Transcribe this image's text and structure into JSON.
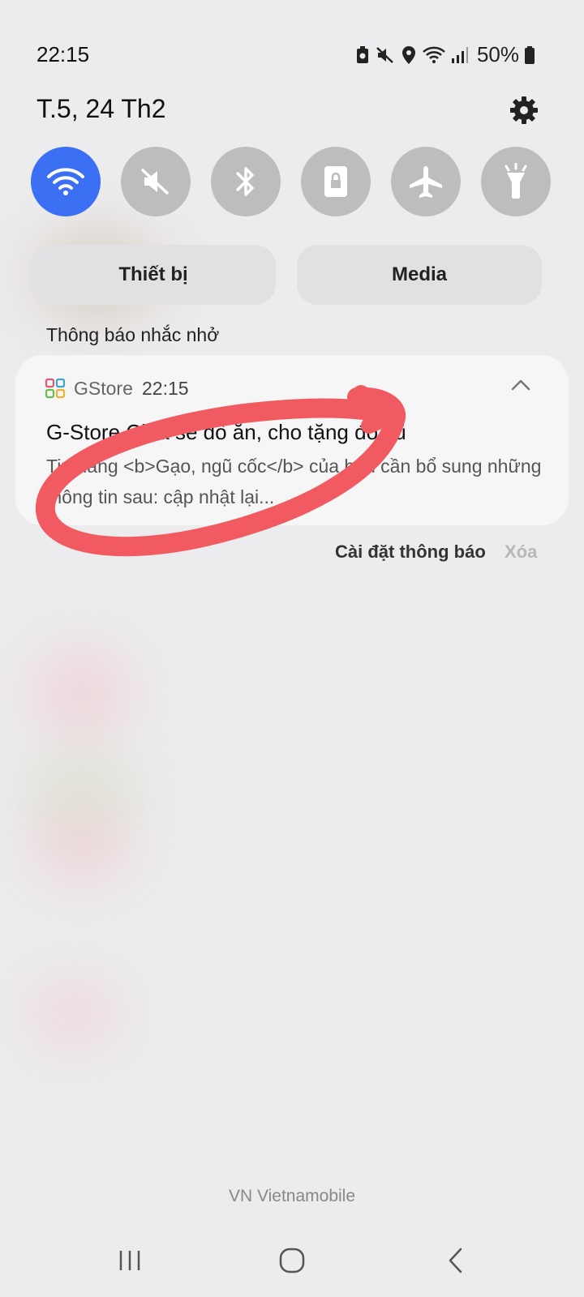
{
  "status_bar": {
    "time": "22:15",
    "battery": "50%",
    "icons": [
      "battery-saver-icon",
      "mute-icon",
      "location-icon",
      "wifi-icon",
      "signal-icon",
      "battery-icon"
    ]
  },
  "header": {
    "date": "T.5, 24 Th2",
    "settings_icon": "gear-icon"
  },
  "quick_settings": {
    "toggles": [
      {
        "name": "wifi",
        "icon": "wifi-icon",
        "active": true
      },
      {
        "name": "sound",
        "icon": "mute-icon",
        "active": false
      },
      {
        "name": "bluetooth",
        "icon": "bluetooth-icon",
        "active": false
      },
      {
        "name": "rotation-lock",
        "icon": "rotation-lock-icon",
        "active": false
      },
      {
        "name": "airplane-mode",
        "icon": "airplane-icon",
        "active": false
      },
      {
        "name": "flashlight",
        "icon": "flashlight-icon",
        "active": false
      }
    ],
    "device_label": "Thiết bị",
    "media_label": "Media"
  },
  "notifications": {
    "section_label": "Thông báo nhắc nhở",
    "items": [
      {
        "app_name": "GStore",
        "time": "22:15",
        "title": "G-Store Chia sẻ đồ ăn, cho tặng đồ cũ",
        "body": "Tin đăng <b>Gạo, ngũ cốc</b> của bạn cần bổ sung những thông tin sau: cập nhật lại..."
      }
    ],
    "settings_label": "Cài đặt thông báo",
    "clear_label": "Xóa"
  },
  "carrier": "VN Vietnamobile",
  "colors": {
    "accent": "#3c70f4",
    "toggle_off": "#bdbdbf",
    "annotation": "#f05a60"
  },
  "nav_bar": {
    "icons": [
      "recent-apps-icon",
      "home-icon",
      "back-icon"
    ]
  }
}
